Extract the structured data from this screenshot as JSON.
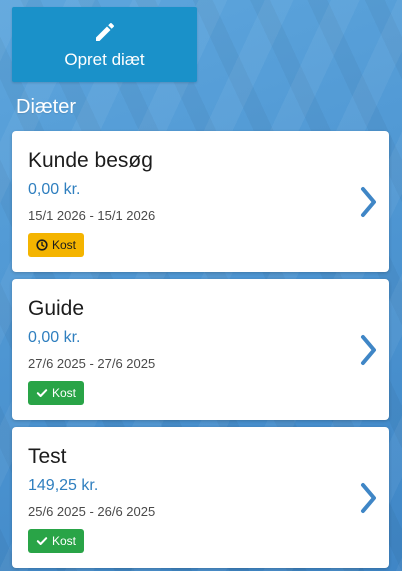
{
  "header": {
    "create_button_label": "Opret diæt",
    "create_button_icon": "pencil-icon"
  },
  "section": {
    "title": "Diæter"
  },
  "diets": [
    {
      "title": "Kunde besøg",
      "price": "0,00 kr.",
      "dates": "15/1 2026 - 15/1 2026",
      "badge": "Kost",
      "badge_status": "pending",
      "badge_icon": "clock-icon",
      "badge_color": "#f4b400"
    },
    {
      "title": "Guide",
      "price": "0,00 kr.",
      "dates": "27/6 2025 - 27/6 2025",
      "badge": "Kost",
      "badge_status": "done",
      "badge_icon": "check-icon",
      "badge_color": "#29a447"
    },
    {
      "title": "Test",
      "price": "149,25 kr.",
      "dates": "25/6 2025 - 26/6 2025",
      "badge": "Kost",
      "badge_status": "done",
      "badge_icon": "check-icon",
      "badge_color": "#29a447"
    }
  ],
  "colors": {
    "primary_button": "#1a91c9",
    "price_text": "#2f7fbf",
    "chevron": "#3f86c6"
  }
}
